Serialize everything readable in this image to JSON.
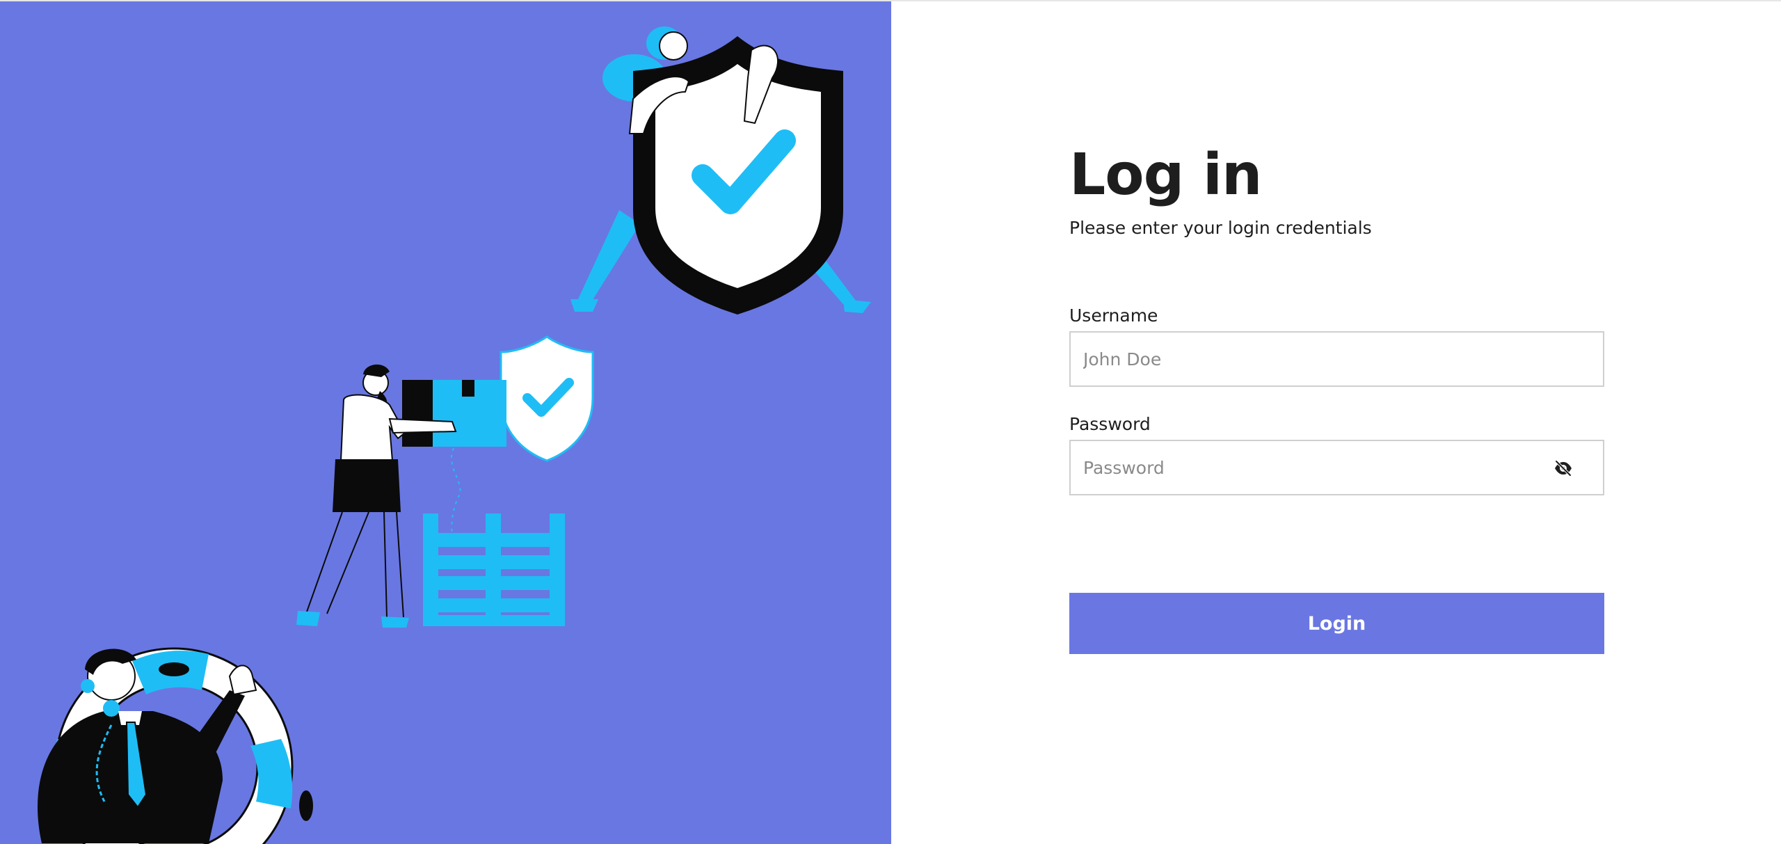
{
  "theme": {
    "accent": "#6a77e2",
    "panel_background": "#6977e2",
    "illustration_cyan": "#1fbdf5",
    "illustration_black": "#0b0b0b",
    "text": "#1e1e1e"
  },
  "illustration": {
    "scene_icons": [
      "shield-check-icon",
      "shield-check-icon",
      "package-box-icon",
      "pallet-icon",
      "lifebuoy-icon"
    ]
  },
  "login": {
    "title": "Log in",
    "subtitle": "Please enter your login credentials",
    "username": {
      "label": "Username",
      "placeholder": "John Doe",
      "value": ""
    },
    "password": {
      "label": "Password",
      "placeholder": "Password",
      "value": "",
      "toggle_icon": "eye-slash-icon"
    },
    "submit_label": "Login"
  }
}
